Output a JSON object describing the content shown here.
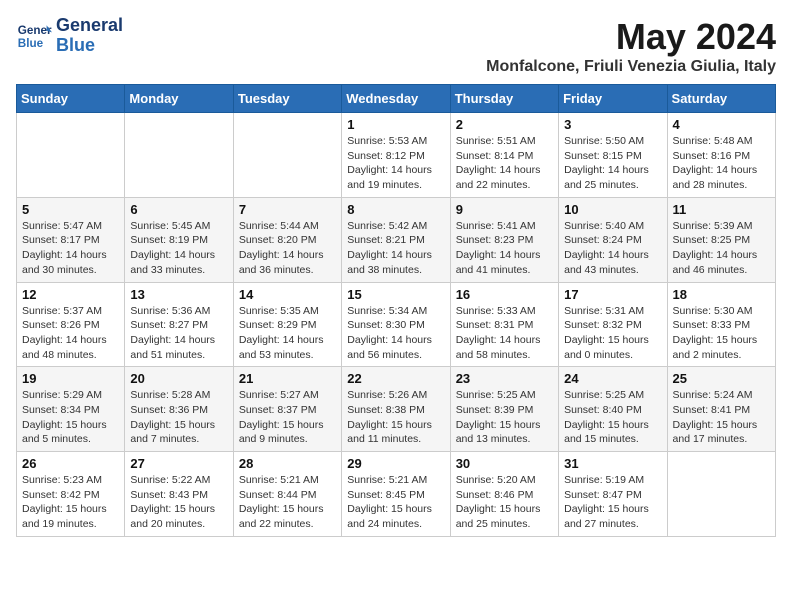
{
  "header": {
    "logo_line1": "General",
    "logo_line2": "Blue",
    "month": "May 2024",
    "location": "Monfalcone, Friuli Venezia Giulia, Italy"
  },
  "weekdays": [
    "Sunday",
    "Monday",
    "Tuesday",
    "Wednesday",
    "Thursday",
    "Friday",
    "Saturday"
  ],
  "weeks": [
    [
      {
        "day": "",
        "info": ""
      },
      {
        "day": "",
        "info": ""
      },
      {
        "day": "",
        "info": ""
      },
      {
        "day": "1",
        "info": "Sunrise: 5:53 AM\nSunset: 8:12 PM\nDaylight: 14 hours\nand 19 minutes."
      },
      {
        "day": "2",
        "info": "Sunrise: 5:51 AM\nSunset: 8:14 PM\nDaylight: 14 hours\nand 22 minutes."
      },
      {
        "day": "3",
        "info": "Sunrise: 5:50 AM\nSunset: 8:15 PM\nDaylight: 14 hours\nand 25 minutes."
      },
      {
        "day": "4",
        "info": "Sunrise: 5:48 AM\nSunset: 8:16 PM\nDaylight: 14 hours\nand 28 minutes."
      }
    ],
    [
      {
        "day": "5",
        "info": "Sunrise: 5:47 AM\nSunset: 8:17 PM\nDaylight: 14 hours\nand 30 minutes."
      },
      {
        "day": "6",
        "info": "Sunrise: 5:45 AM\nSunset: 8:19 PM\nDaylight: 14 hours\nand 33 minutes."
      },
      {
        "day": "7",
        "info": "Sunrise: 5:44 AM\nSunset: 8:20 PM\nDaylight: 14 hours\nand 36 minutes."
      },
      {
        "day": "8",
        "info": "Sunrise: 5:42 AM\nSunset: 8:21 PM\nDaylight: 14 hours\nand 38 minutes."
      },
      {
        "day": "9",
        "info": "Sunrise: 5:41 AM\nSunset: 8:23 PM\nDaylight: 14 hours\nand 41 minutes."
      },
      {
        "day": "10",
        "info": "Sunrise: 5:40 AM\nSunset: 8:24 PM\nDaylight: 14 hours\nand 43 minutes."
      },
      {
        "day": "11",
        "info": "Sunrise: 5:39 AM\nSunset: 8:25 PM\nDaylight: 14 hours\nand 46 minutes."
      }
    ],
    [
      {
        "day": "12",
        "info": "Sunrise: 5:37 AM\nSunset: 8:26 PM\nDaylight: 14 hours\nand 48 minutes."
      },
      {
        "day": "13",
        "info": "Sunrise: 5:36 AM\nSunset: 8:27 PM\nDaylight: 14 hours\nand 51 minutes."
      },
      {
        "day": "14",
        "info": "Sunrise: 5:35 AM\nSunset: 8:29 PM\nDaylight: 14 hours\nand 53 minutes."
      },
      {
        "day": "15",
        "info": "Sunrise: 5:34 AM\nSunset: 8:30 PM\nDaylight: 14 hours\nand 56 minutes."
      },
      {
        "day": "16",
        "info": "Sunrise: 5:33 AM\nSunset: 8:31 PM\nDaylight: 14 hours\nand 58 minutes."
      },
      {
        "day": "17",
        "info": "Sunrise: 5:31 AM\nSunset: 8:32 PM\nDaylight: 15 hours\nand 0 minutes."
      },
      {
        "day": "18",
        "info": "Sunrise: 5:30 AM\nSunset: 8:33 PM\nDaylight: 15 hours\nand 2 minutes."
      }
    ],
    [
      {
        "day": "19",
        "info": "Sunrise: 5:29 AM\nSunset: 8:34 PM\nDaylight: 15 hours\nand 5 minutes."
      },
      {
        "day": "20",
        "info": "Sunrise: 5:28 AM\nSunset: 8:36 PM\nDaylight: 15 hours\nand 7 minutes."
      },
      {
        "day": "21",
        "info": "Sunrise: 5:27 AM\nSunset: 8:37 PM\nDaylight: 15 hours\nand 9 minutes."
      },
      {
        "day": "22",
        "info": "Sunrise: 5:26 AM\nSunset: 8:38 PM\nDaylight: 15 hours\nand 11 minutes."
      },
      {
        "day": "23",
        "info": "Sunrise: 5:25 AM\nSunset: 8:39 PM\nDaylight: 15 hours\nand 13 minutes."
      },
      {
        "day": "24",
        "info": "Sunrise: 5:25 AM\nSunset: 8:40 PM\nDaylight: 15 hours\nand 15 minutes."
      },
      {
        "day": "25",
        "info": "Sunrise: 5:24 AM\nSunset: 8:41 PM\nDaylight: 15 hours\nand 17 minutes."
      }
    ],
    [
      {
        "day": "26",
        "info": "Sunrise: 5:23 AM\nSunset: 8:42 PM\nDaylight: 15 hours\nand 19 minutes."
      },
      {
        "day": "27",
        "info": "Sunrise: 5:22 AM\nSunset: 8:43 PM\nDaylight: 15 hours\nand 20 minutes."
      },
      {
        "day": "28",
        "info": "Sunrise: 5:21 AM\nSunset: 8:44 PM\nDaylight: 15 hours\nand 22 minutes."
      },
      {
        "day": "29",
        "info": "Sunrise: 5:21 AM\nSunset: 8:45 PM\nDaylight: 15 hours\nand 24 minutes."
      },
      {
        "day": "30",
        "info": "Sunrise: 5:20 AM\nSunset: 8:46 PM\nDaylight: 15 hours\nand 25 minutes."
      },
      {
        "day": "31",
        "info": "Sunrise: 5:19 AM\nSunset: 8:47 PM\nDaylight: 15 hours\nand 27 minutes."
      },
      {
        "day": "",
        "info": ""
      }
    ]
  ]
}
